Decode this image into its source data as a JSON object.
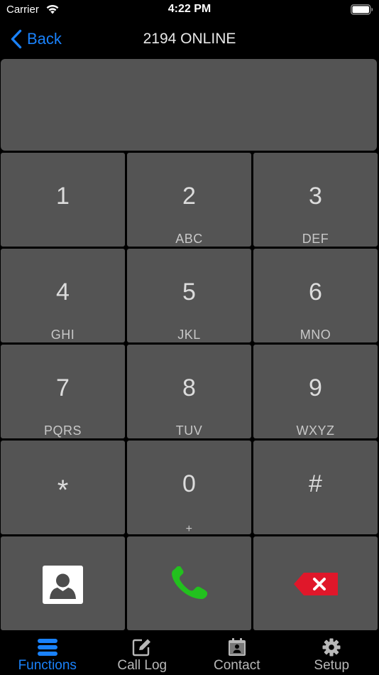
{
  "status_bar": {
    "carrier": "Carrier",
    "time": "4:22 PM"
  },
  "nav": {
    "back_label": "Back",
    "title": "2194 ONLINE"
  },
  "display": {
    "number": ""
  },
  "keypad": {
    "keys": [
      {
        "digit": "1",
        "letters": ""
      },
      {
        "digit": "2",
        "letters": "ABC"
      },
      {
        "digit": "3",
        "letters": "DEF"
      },
      {
        "digit": "4",
        "letters": "GHI"
      },
      {
        "digit": "5",
        "letters": "JKL"
      },
      {
        "digit": "6",
        "letters": "MNO"
      },
      {
        "digit": "7",
        "letters": "PQRS"
      },
      {
        "digit": "8",
        "letters": "TUV"
      },
      {
        "digit": "9",
        "letters": "WXYZ"
      },
      {
        "digit": "*",
        "letters": ""
      },
      {
        "digit": "0",
        "letters": "+"
      },
      {
        "digit": "#",
        "letters": ""
      }
    ],
    "actions": {
      "contacts_icon": "contact-card-icon",
      "call_icon": "phone-handset-icon",
      "delete_icon": "backspace-delete-icon"
    }
  },
  "tabs": [
    {
      "label": "Functions",
      "icon": "menu-bars-icon",
      "active": true
    },
    {
      "label": "Call Log",
      "icon": "edit-note-icon",
      "active": false
    },
    {
      "label": "Contact",
      "icon": "calendar-contact-icon",
      "active": false
    },
    {
      "label": "Setup",
      "icon": "gear-icon",
      "active": false
    }
  ],
  "colors": {
    "accent": "#1a82fb",
    "key_background": "#545454",
    "call_green": "#22c11e",
    "delete_red": "#e0172a",
    "inactive_tab": "#b8b8b8"
  }
}
